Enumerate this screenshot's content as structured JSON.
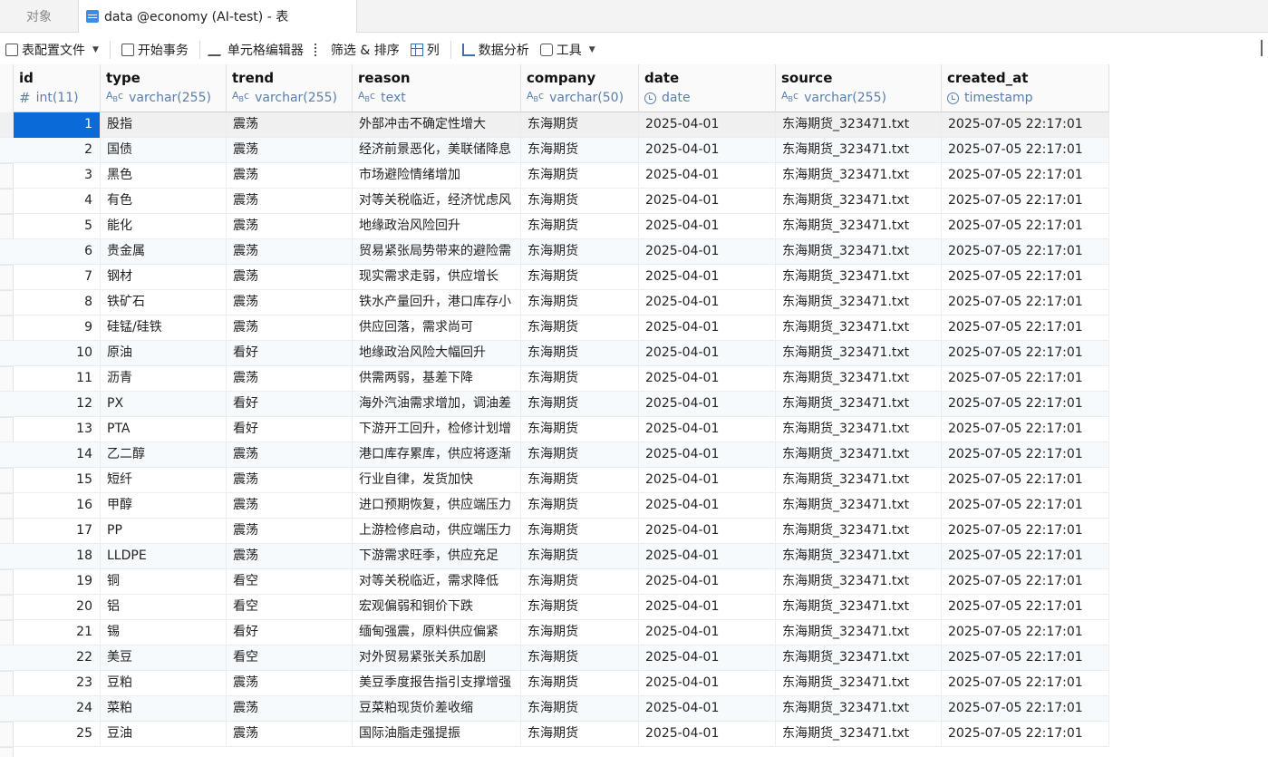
{
  "tabs": {
    "objects": "对象",
    "active": "data @economy (AI-test) - 表"
  },
  "toolbar": {
    "table_config": "表配置文件",
    "begin_transaction": "开始事务",
    "cell_editor": "单元格编辑器",
    "filter_sort": "筛选 & 排序",
    "columns": "列",
    "data_analysis": "数据分析",
    "tools": "工具"
  },
  "columns": [
    {
      "name": "id",
      "type": "int(11)",
      "icon": "number-icon"
    },
    {
      "name": "type",
      "type": "varchar(255)",
      "icon": "text-type-icon"
    },
    {
      "name": "trend",
      "type": "varchar(255)",
      "icon": "text-type-icon"
    },
    {
      "name": "reason",
      "type": "text",
      "icon": "text-type-icon"
    },
    {
      "name": "company",
      "type": "varchar(50)",
      "icon": "text-type-icon"
    },
    {
      "name": "date",
      "type": "date",
      "icon": "clock-icon"
    },
    {
      "name": "source",
      "type": "varchar(255)",
      "icon": "text-type-icon"
    },
    {
      "name": "created_at",
      "type": "timestamp",
      "icon": "clock-icon"
    }
  ],
  "rows": [
    [
      "1",
      "股指",
      "震荡",
      "外部冲击不确定性增大",
      "东海期货",
      "2025-04-01",
      "东海期货_323471.txt",
      "2025-07-05 22:17:01"
    ],
    [
      "2",
      "国债",
      "震荡",
      "经济前景恶化，美联储降息",
      "东海期货",
      "2025-04-01",
      "东海期货_323471.txt",
      "2025-07-05 22:17:01"
    ],
    [
      "3",
      "黑色",
      "震荡",
      "市场避险情绪增加",
      "东海期货",
      "2025-04-01",
      "东海期货_323471.txt",
      "2025-07-05 22:17:01"
    ],
    [
      "4",
      "有色",
      "震荡",
      "对等关税临近，经济忧虑风",
      "东海期货",
      "2025-04-01",
      "东海期货_323471.txt",
      "2025-07-05 22:17:01"
    ],
    [
      "5",
      "能化",
      "震荡",
      "地缘政治风险回升",
      "东海期货",
      "2025-04-01",
      "东海期货_323471.txt",
      "2025-07-05 22:17:01"
    ],
    [
      "6",
      "贵金属",
      "震荡",
      "贸易紧张局势带来的避险需",
      "东海期货",
      "2025-04-01",
      "东海期货_323471.txt",
      "2025-07-05 22:17:01"
    ],
    [
      "7",
      "钢材",
      "震荡",
      "现实需求走弱，供应增长",
      "东海期货",
      "2025-04-01",
      "东海期货_323471.txt",
      "2025-07-05 22:17:01"
    ],
    [
      "8",
      "铁矿石",
      "震荡",
      "铁水产量回升，港口库存小",
      "东海期货",
      "2025-04-01",
      "东海期货_323471.txt",
      "2025-07-05 22:17:01"
    ],
    [
      "9",
      "硅锰/硅铁",
      "震荡",
      "供应回落，需求尚可",
      "东海期货",
      "2025-04-01",
      "东海期货_323471.txt",
      "2025-07-05 22:17:01"
    ],
    [
      "10",
      "原油",
      "看好",
      "地缘政治风险大幅回升",
      "东海期货",
      "2025-04-01",
      "东海期货_323471.txt",
      "2025-07-05 22:17:01"
    ],
    [
      "11",
      "沥青",
      "震荡",
      "供需两弱，基差下降",
      "东海期货",
      "2025-04-01",
      "东海期货_323471.txt",
      "2025-07-05 22:17:01"
    ],
    [
      "12",
      "PX",
      "看好",
      "海外汽油需求增加，调油差",
      "东海期货",
      "2025-04-01",
      "东海期货_323471.txt",
      "2025-07-05 22:17:01"
    ],
    [
      "13",
      "PTA",
      "看好",
      "下游开工回升，检修计划增",
      "东海期货",
      "2025-04-01",
      "东海期货_323471.txt",
      "2025-07-05 22:17:01"
    ],
    [
      "14",
      "乙二醇",
      "震荡",
      "港口库存累库，供应将逐渐",
      "东海期货",
      "2025-04-01",
      "东海期货_323471.txt",
      "2025-07-05 22:17:01"
    ],
    [
      "15",
      "短纤",
      "震荡",
      "行业自律，发货加快",
      "东海期货",
      "2025-04-01",
      "东海期货_323471.txt",
      "2025-07-05 22:17:01"
    ],
    [
      "16",
      "甲醇",
      "震荡",
      "进口预期恢复，供应端压力",
      "东海期货",
      "2025-04-01",
      "东海期货_323471.txt",
      "2025-07-05 22:17:01"
    ],
    [
      "17",
      "PP",
      "震荡",
      "上游检修启动，供应端压力",
      "东海期货",
      "2025-04-01",
      "东海期货_323471.txt",
      "2025-07-05 22:17:01"
    ],
    [
      "18",
      "LLDPE",
      "震荡",
      "下游需求旺季，供应充足",
      "东海期货",
      "2025-04-01",
      "东海期货_323471.txt",
      "2025-07-05 22:17:01"
    ],
    [
      "19",
      "铜",
      "看空",
      "对等关税临近，需求降低",
      "东海期货",
      "2025-04-01",
      "东海期货_323471.txt",
      "2025-07-05 22:17:01"
    ],
    [
      "20",
      "铝",
      "看空",
      "宏观偏弱和铜价下跌",
      "东海期货",
      "2025-04-01",
      "东海期货_323471.txt",
      "2025-07-05 22:17:01"
    ],
    [
      "21",
      "锡",
      "看好",
      "缅甸强震，原料供应偏紧",
      "东海期货",
      "2025-04-01",
      "东海期货_323471.txt",
      "2025-07-05 22:17:01"
    ],
    [
      "22",
      "美豆",
      "看空",
      "对外贸易紧张关系加剧",
      "东海期货",
      "2025-04-01",
      "东海期货_323471.txt",
      "2025-07-05 22:17:01"
    ],
    [
      "23",
      "豆粕",
      "震荡",
      "美豆季度报告指引支撑增强",
      "东海期货",
      "2025-04-01",
      "东海期货_323471.txt",
      "2025-07-05 22:17:01"
    ],
    [
      "24",
      "菜粕",
      "震荡",
      "豆菜粕现货价差收缩",
      "东海期货",
      "2025-04-01",
      "东海期货_323471.txt",
      "2025-07-05 22:17:01"
    ],
    [
      "25",
      "豆油",
      "震荡",
      "国际油脂走强提振",
      "东海期货",
      "2025-04-01",
      "东海期货_323471.txt",
      "2025-07-05 22:17:01"
    ]
  ],
  "selected_row": 0,
  "accent_color": "#0a6ad7"
}
